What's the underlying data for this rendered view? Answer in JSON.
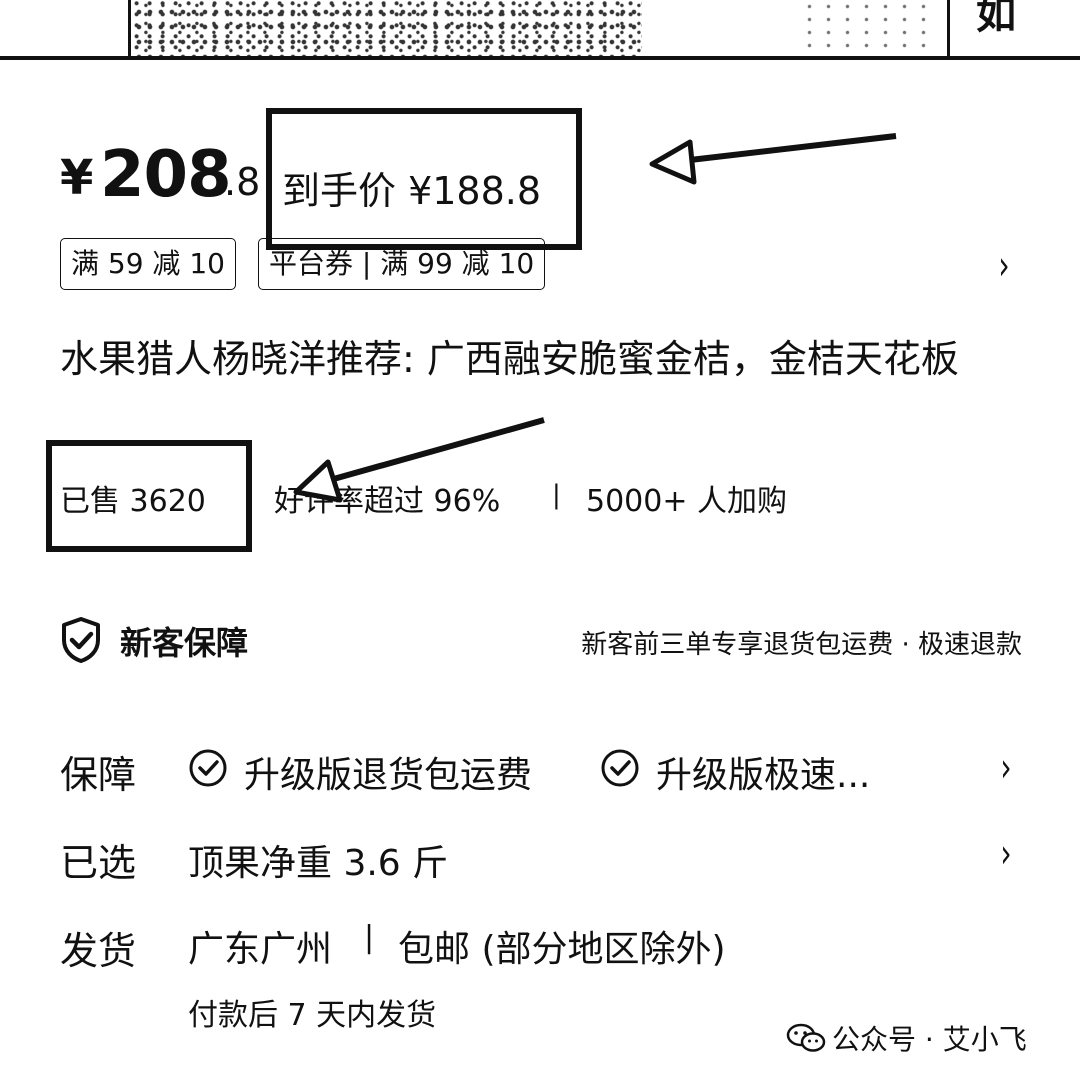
{
  "top_image": {
    "corner_text": "如"
  },
  "price": {
    "currency": "¥",
    "integer": "208",
    "decimal": ".8",
    "final_label": "到手价 ¥188.8"
  },
  "coupons": [
    {
      "text": "满 59 减 10"
    },
    {
      "text": "平台券 | 满 99 减 10"
    }
  ],
  "title": "水果猎人杨晓洋推荐: 广西融安脆蜜金桔，金桔天花板",
  "stats": {
    "sold": "已售 3620",
    "rating": "好评率超过 96%",
    "separator": "|",
    "cart": "5000+ 人加购"
  },
  "new_customer": {
    "title": "新客保障",
    "desc": "新客前三单专享退货包运费 · 极速退款"
  },
  "rows": {
    "guarantee": {
      "label": "保障",
      "items": [
        "升级版退货包运费",
        "升级版极速..."
      ]
    },
    "selected": {
      "label": "已选",
      "value": "顶果净重 3.6 斤"
    },
    "shipping": {
      "label": "发货",
      "from": "广东广州",
      "separator": "|",
      "free": "包邮 (部分地区除外)",
      "time": "付款后 7 天内发货"
    }
  },
  "watermark": "公众号 · 艾小飞",
  "icons": {
    "chevron": "›",
    "shield": "shield-check-icon",
    "check": "check-circle-icon",
    "wechat": "wechat-icon"
  }
}
